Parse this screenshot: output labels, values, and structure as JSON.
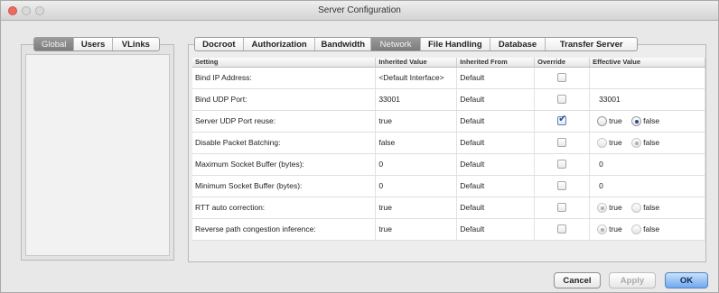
{
  "window": {
    "title": "Server Configuration"
  },
  "left_tabs": [
    {
      "label": "Global",
      "selected": true
    },
    {
      "label": "Users",
      "selected": false
    },
    {
      "label": "VLinks",
      "selected": false
    }
  ],
  "main_tabs": [
    {
      "label": "Docroot",
      "selected": false
    },
    {
      "label": "Authorization",
      "selected": false
    },
    {
      "label": "Bandwidth",
      "selected": false
    },
    {
      "label": "Network",
      "selected": true
    },
    {
      "label": "File Handling",
      "selected": false
    },
    {
      "label": "Database",
      "selected": false
    },
    {
      "label": "Transfer Server",
      "selected": false
    }
  ],
  "table": {
    "columns": [
      "Setting",
      "Inherited Value",
      "Inherited From",
      "Override",
      "Effective Value"
    ],
    "rows": [
      {
        "setting": "Bind IP Address:",
        "inherited_value": "<Default Interface>",
        "inherited_from": "Default",
        "override": false,
        "effective": "",
        "effective_type": "none"
      },
      {
        "setting": "Bind UDP Port:",
        "inherited_value": "33001",
        "inherited_from": "Default",
        "override": false,
        "effective": "33001",
        "effective_type": "text"
      },
      {
        "setting": "Server UDP Port reuse:",
        "inherited_value": "true",
        "inherited_from": "Default",
        "override": true,
        "effective": "false",
        "effective_type": "radio-enabled"
      },
      {
        "setting": "Disable Packet Batching:",
        "inherited_value": "false",
        "inherited_from": "Default",
        "override": false,
        "effective": "false",
        "effective_type": "radio"
      },
      {
        "setting": "Maximum Socket Buffer (bytes):",
        "inherited_value": "0",
        "inherited_from": "Default",
        "override": false,
        "effective": "0",
        "effective_type": "text"
      },
      {
        "setting": "Minimum Socket Buffer (bytes):",
        "inherited_value": "0",
        "inherited_from": "Default",
        "override": false,
        "effective": "0",
        "effective_type": "text"
      },
      {
        "setting": "RTT auto correction:",
        "inherited_value": "true",
        "inherited_from": "Default",
        "override": false,
        "effective": "true",
        "effective_type": "radio"
      },
      {
        "setting": "Reverse path congestion inference:",
        "inherited_value": "true",
        "inherited_from": "Default",
        "override": false,
        "effective": "true",
        "effective_type": "radio"
      }
    ]
  },
  "radio_labels": {
    "true": "true",
    "false": "false"
  },
  "buttons": {
    "cancel": "Cancel",
    "apply": "Apply",
    "ok": "OK"
  }
}
